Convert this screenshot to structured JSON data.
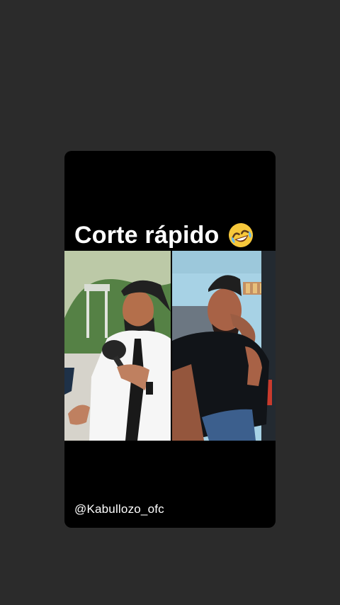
{
  "post": {
    "caption": "Corte rápido",
    "caption_emoji": "rolling-on-the-floor-laughing-emoji",
    "username": "@Kabullozo_ofc"
  },
  "colors": {
    "background": "#2b2b2b",
    "card": "#000000",
    "text": "#ffffff"
  }
}
